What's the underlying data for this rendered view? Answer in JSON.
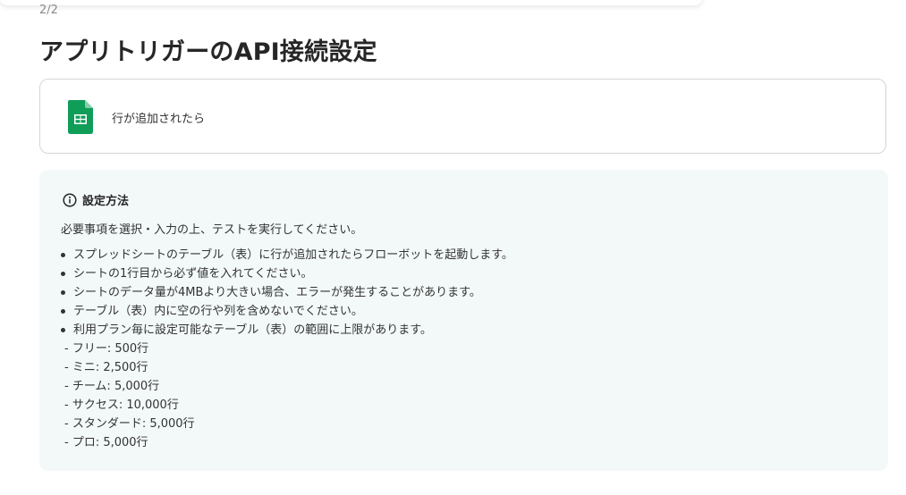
{
  "header": {
    "step": "2/2",
    "title": "アプリトリガーのAPI接続設定"
  },
  "trigger": {
    "icon": "google-sheets-icon",
    "label": "行が追加されたら",
    "icon_color": "#0f9d58"
  },
  "info": {
    "heading_icon": "info-icon",
    "heading": "設定方法",
    "intro": "必要事項を選択・入力の上、テストを実行してください。",
    "bullets": [
      "スプレッドシートのテーブル（表）に行が追加されたらフローボットを起動します。",
      "シートの1行目から必ず値を入れてください。",
      "シートのデータ量が4MBより大きい場合、エラーが発生することがあります。",
      "テーブル（表）内に空の行や列を含めないでください。",
      "利用プラン毎に設定可能なテーブル（表）の範囲に上限があります。"
    ],
    "plan_limits": [
      "- フリー: 500行",
      "- ミニ: 2,500行",
      "- チーム: 5,000行",
      "- サクセス: 10,000行",
      "- スタンダード: 5,000行",
      "- プロ: 5,000行"
    ],
    "background_color": "#f3f9f8"
  }
}
